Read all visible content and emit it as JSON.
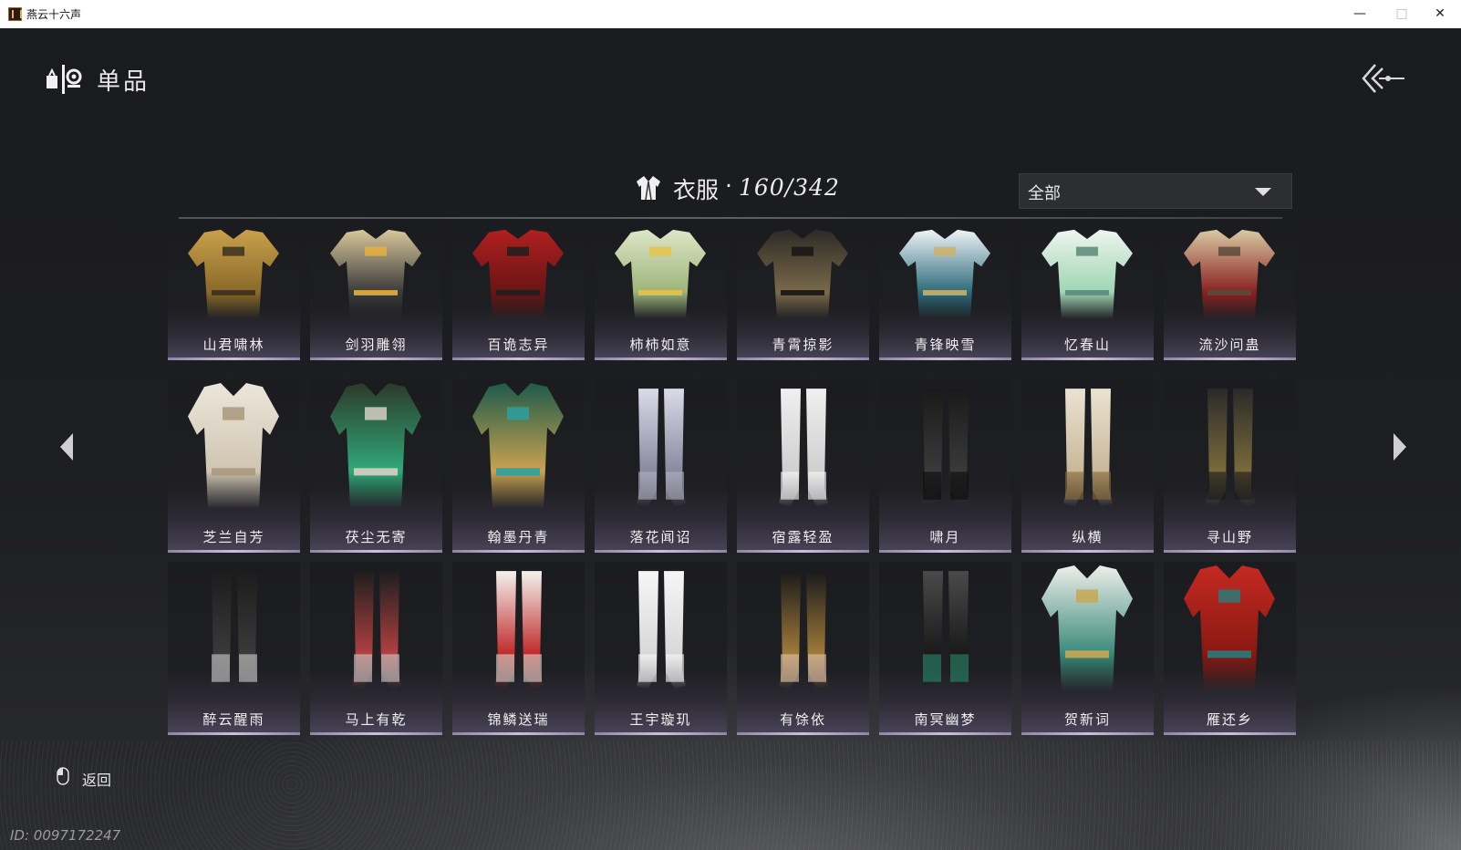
{
  "window": {
    "title": "燕云十六声",
    "minimize": "—",
    "maximize": "□",
    "close": "✕"
  },
  "page": {
    "title": "单品",
    "icon": "wardrobe-emblem-icon"
  },
  "category": {
    "label": "衣服",
    "separator": "·",
    "count": "160/342",
    "icon": "robe-icon"
  },
  "filter": {
    "selected": "全部"
  },
  "items": [
    {
      "name": "山君啸林",
      "palette": [
        "#c9a04a",
        "#8a6a2a",
        "#3a3020"
      ]
    },
    {
      "name": "剑羽雕翎",
      "palette": [
        "#d8c79a",
        "#3a3a3a",
        "#e6b040"
      ]
    },
    {
      "name": "百诡志异",
      "palette": [
        "#b02020",
        "#6a1414",
        "#1e1e1e"
      ]
    },
    {
      "name": "柿柿如意",
      "palette": [
        "#dfe6c6",
        "#9cb47a",
        "#e8c24a"
      ]
    },
    {
      "name": "青霄掠影",
      "palette": [
        "#2e2a26",
        "#7a6a4a",
        "#151515"
      ]
    },
    {
      "name": "青锋映雪",
      "palette": [
        "#eef2f6",
        "#2c6a7a",
        "#cdb06a"
      ]
    },
    {
      "name": "忆春山",
      "palette": [
        "#eef4ee",
        "#9ed6b2",
        "#5a8a7a"
      ]
    },
    {
      "name": "流沙问蛊",
      "palette": [
        "#d8c9a2",
        "#8a2020",
        "#5a4a3a"
      ]
    },
    {
      "name": "芝兰自芳",
      "palette": [
        "#ece6da",
        "#cfc5b2",
        "#a8997c"
      ]
    },
    {
      "name": "茯尘无寄",
      "palette": [
        "#2c3a2a",
        "#30a878",
        "#d6d0c2"
      ]
    },
    {
      "name": "翰墨丹青",
      "palette": [
        "#1e5a4a",
        "#c8a250",
        "#2aa0a0"
      ]
    },
    {
      "name": "落花闻诏",
      "palette": [
        "#dadae8",
        "#8a8aa0",
        "#b6b6c8"
      ]
    },
    {
      "name": "宿露轻盈",
      "palette": [
        "#f0f0f0",
        "#cfcfcf",
        "#ffffff"
      ]
    },
    {
      "name": "啸月",
      "palette": [
        "#1a1a1a",
        "#3a3a3a",
        "#0c0c0c"
      ]
    },
    {
      "name": "纵横",
      "palette": [
        "#eae2d2",
        "#c9b89a",
        "#8a6a3a"
      ]
    },
    {
      "name": "寻山野",
      "palette": [
        "#2a2a2a",
        "#7a6a3a",
        "#1a1a1a"
      ]
    },
    {
      "name": "醉云醒雨",
      "palette": [
        "#1c1c1c",
        "#3a3a3a",
        "#d0d0d0"
      ]
    },
    {
      "name": "马上有乾",
      "palette": [
        "#1e1e1e",
        "#b04040",
        "#d0d0d0"
      ]
    },
    {
      "name": "锦鳞送瑞",
      "palette": [
        "#f4f2ee",
        "#c02a2a",
        "#e0dcd4"
      ]
    },
    {
      "name": "王宇璇玑",
      "palette": [
        "#f6f6f6",
        "#d8d8d8",
        "#ffffff"
      ]
    },
    {
      "name": "有馀依",
      "palette": [
        "#1a1a1a",
        "#a07a3a",
        "#e8c8b0"
      ]
    },
    {
      "name": "南冥幽梦",
      "palette": [
        "#4a4a4a",
        "#1a1a1a",
        "#2a8a6a"
      ]
    },
    {
      "name": "贺新词",
      "palette": [
        "#eeeeea",
        "#3a8a7a",
        "#c8a850"
      ]
    },
    {
      "name": "雁还乡",
      "palette": [
        "#c42a22",
        "#8a1812",
        "#2a7a7a"
      ]
    }
  ],
  "nav": {
    "prev": "chevron-left-icon",
    "next": "chevron-right-icon"
  },
  "footer": {
    "return_label": "返回",
    "return_icon": "mouse-icon",
    "id_text": "ID: 0097172247"
  }
}
